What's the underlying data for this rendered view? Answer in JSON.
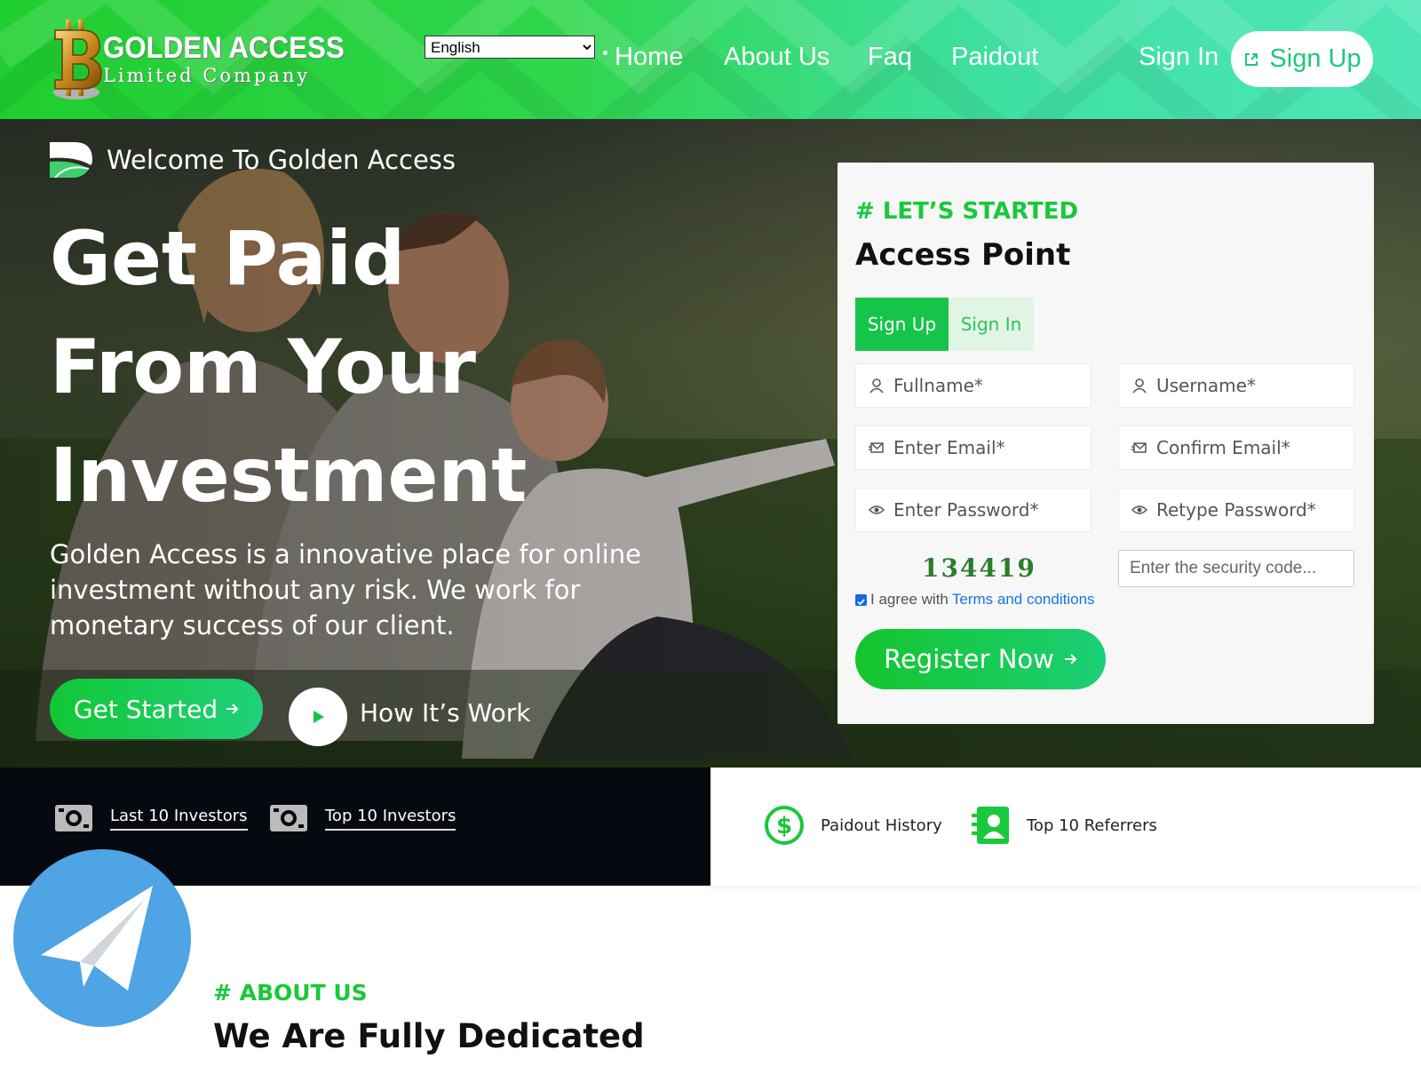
{
  "header": {
    "logo": {
      "line1": "GOLDEN ACCESS",
      "line2": "Limited Company"
    },
    "language": {
      "selected": "English"
    },
    "nav": [
      "Home",
      "About Us",
      "Faq",
      "Paidout"
    ],
    "sign_in": "Sign In",
    "sign_up": "Sign Up"
  },
  "hero": {
    "welcome": "Welcome To Golden Access",
    "title_lines": [
      "Get Paid",
      "From Your",
      "Investment"
    ],
    "description": "Golden Access is a innovative place for online investment without any risk. We work for monetary success of our client.",
    "get_started": "Get Started",
    "how_it_works": "How It’s Work"
  },
  "form": {
    "tag": "# LET’S STARTED",
    "title": "Access Point",
    "tabs": [
      "Sign Up",
      "Sign In"
    ],
    "fields": {
      "fullname": "Fullname*",
      "username": "Username*",
      "email": "Enter Email*",
      "confirm_email": "Confirm Email*",
      "password": "Enter Password*",
      "retype_password": "Retype Password*"
    },
    "captcha": "134419",
    "security_placeholder": "Enter the security code...",
    "agree_text": "I agree with",
    "agree_link": "Terms and conditions",
    "agree_checked": true,
    "register": "Register Now"
  },
  "stats": {
    "last_investors": "Last 10 Investors",
    "top_investors": "Top 10 Investors",
    "paidout_history": "Paidout History",
    "top_referrers": "Top 10 Referrers"
  },
  "about": {
    "tag": "# ABOUT US",
    "title": "We Are Fully Dedicated"
  },
  "colors": {
    "brand_green": "#19c83b",
    "teal": "#1cc97a",
    "dark": "#06090f",
    "link_blue": "#1a73e8",
    "telegram_blue": "#4ea4e4"
  }
}
